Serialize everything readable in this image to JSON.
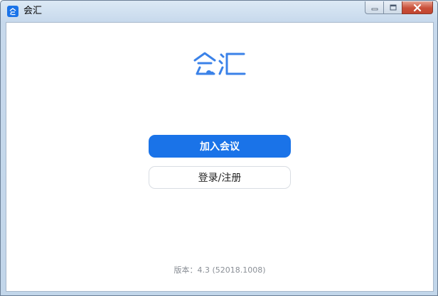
{
  "window": {
    "title": "会汇",
    "icon": "app-logo-icon",
    "controls": [
      "minimize-icon",
      "maximize-icon",
      "close-icon"
    ]
  },
  "logo": {
    "text": "会汇",
    "icon": "huihui-logo-icon",
    "color": "#3b82e8"
  },
  "actions": {
    "join_meeting": "加入会议",
    "login_register": "登录/注册"
  },
  "footer": {
    "version": "版本：4.3 (52018.1008)"
  },
  "colors": {
    "primary": "#1a73e8",
    "close_button": "#c9503a",
    "version_text": "#8a8f96"
  }
}
